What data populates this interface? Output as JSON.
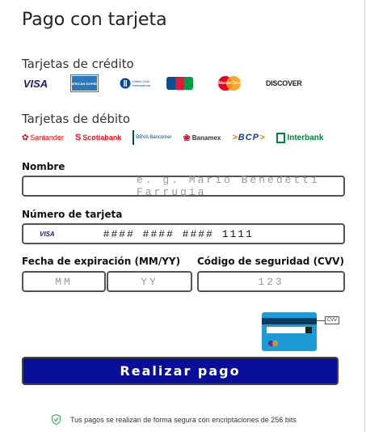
{
  "title": "Pago con tarjeta",
  "credit": {
    "label": "Tarjetas de crédito",
    "logos": [
      {
        "name": "visa",
        "text": "VISA",
        "color": "#1a1f71"
      },
      {
        "name": "amex",
        "text": "AMERICAN EXPRESS",
        "color": "#2e77bb"
      },
      {
        "name": "diners",
        "text": "Diners Club International",
        "color": "#004a97"
      },
      {
        "name": "jcb",
        "text": "JCB",
        "color": "#0e4c96"
      },
      {
        "name": "mastercard",
        "text": "MasterCard",
        "color": "#eb001b"
      },
      {
        "name": "discover",
        "text": "DISCOVER",
        "color": "#222222"
      }
    ]
  },
  "debit": {
    "label": "Tarjetas de débito",
    "logos": [
      {
        "name": "santander",
        "text": "Santander",
        "color": "#ec0000"
      },
      {
        "name": "scotiabank",
        "text": "Scotiabank",
        "color": "#ec111a"
      },
      {
        "name": "bbva",
        "text": "BBVA Bancomer",
        "color": "#004481"
      },
      {
        "name": "banamex",
        "text": "Banamex",
        "color": "#c8102e"
      },
      {
        "name": "bcp",
        "text": "BCP",
        "color": "#1a3b8c"
      },
      {
        "name": "interbank",
        "text": "Interbank",
        "color": "#00843d"
      }
    ]
  },
  "form": {
    "name_label": "Nombre",
    "name_placeholder": "e. g. Mario Benedetti Farrugia",
    "card_label": "Número de tarjeta",
    "card_brand": "VISA",
    "card_value": "#### #### #### 1111",
    "expiry_label": "Fecha de expiración (MM/YY)",
    "month_placeholder": "MM",
    "year_placeholder": "YY",
    "cvv_label": "Código de seguridad (CVV)",
    "cvv_placeholder": "123",
    "cvv_hint": "CVV"
  },
  "pay_button": "Realizar pago",
  "secure_text": "Tus pagos se realizan de forma segura con encriptaciones de 256 bits",
  "colors": {
    "button": "#0a0f9a",
    "cvv_card": "#1e9ad6",
    "shield": "#3aa35b"
  }
}
